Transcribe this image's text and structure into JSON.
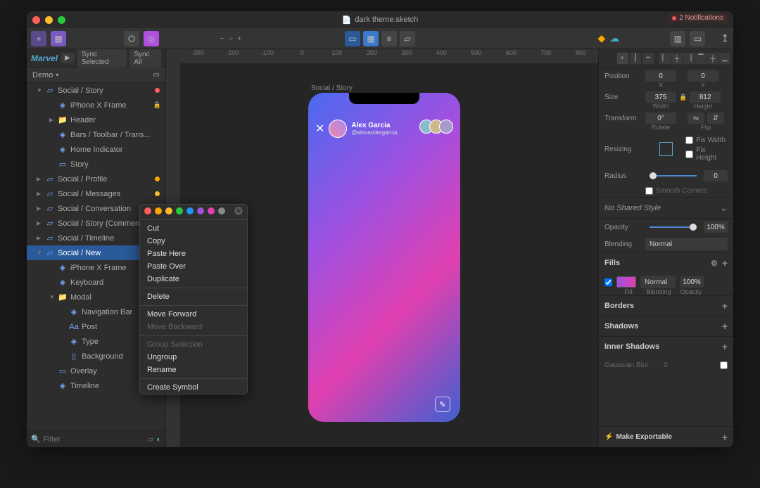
{
  "window": {
    "title": "dark theme.sketch",
    "notifications": "2 Notifications"
  },
  "colors": {
    "red": "#ff5f56",
    "yellow": "#ffbd2e",
    "green": "#27c93f",
    "orange": "#ffa500",
    "blue": "#2196f3",
    "purple": "#a050e0",
    "pink": "#e040b0",
    "gray": "#888"
  },
  "marvel": {
    "logo": "Marvel",
    "play": "▶",
    "sync_selected": "Sync Selected",
    "sync_all": "Sync All"
  },
  "page": {
    "name": "Demo"
  },
  "ruler_marks": [
    "-300",
    "-200",
    "-100",
    "0",
    "100",
    "200",
    "300",
    "400",
    "500",
    "600",
    "700",
    "800"
  ],
  "layers": [
    {
      "id": "l0",
      "caret": "▼",
      "name": "Social / Story",
      "indent": "i1",
      "icon": "artboard",
      "dot": "#ff5f56",
      "sel": false
    },
    {
      "id": "l1",
      "caret": "",
      "name": "iPhone X Frame",
      "indent": "i2",
      "icon": "symbol",
      "lock": true
    },
    {
      "id": "l2",
      "caret": "▶",
      "name": "Header",
      "indent": "i2",
      "icon": "folder"
    },
    {
      "id": "l3",
      "caret": "",
      "name": "Bars / Toolbar / Trans...",
      "indent": "i2",
      "icon": "symbol"
    },
    {
      "id": "l4",
      "caret": "",
      "name": "Home Indicator",
      "indent": "i2",
      "icon": "symbol"
    },
    {
      "id": "l5",
      "caret": "",
      "name": "Story",
      "indent": "i2",
      "icon": "rect"
    },
    {
      "id": "l6",
      "caret": "▶",
      "name": "Social / Profile",
      "indent": "i1",
      "icon": "artboard",
      "dot": "#ffa500"
    },
    {
      "id": "l7",
      "caret": "▶",
      "name": "Social / Messages",
      "indent": "i1",
      "icon": "artboard",
      "dot": "#ffbd2e"
    },
    {
      "id": "l8",
      "caret": "▶",
      "name": "Social / Conversation",
      "indent": "i1",
      "icon": "artboard",
      "dot": "#ffa500"
    },
    {
      "id": "l9",
      "caret": "▶",
      "name": "Social / Story (Comments)",
      "indent": "i1",
      "icon": "artboard",
      "dot": "#27c93f"
    },
    {
      "id": "l10",
      "caret": "▶",
      "name": "Social / Timeline",
      "indent": "i1",
      "icon": "artboard",
      "dot": "#2196f3"
    },
    {
      "id": "l11",
      "caret": "▼",
      "name": "Social / New",
      "indent": "i1",
      "icon": "artboard",
      "sel": true
    },
    {
      "id": "l12",
      "caret": "",
      "name": "iPhone X Frame",
      "indent": "i2",
      "icon": "symbol",
      "lock": true
    },
    {
      "id": "l13",
      "caret": "",
      "name": "Keyboard",
      "indent": "i2",
      "icon": "symbol"
    },
    {
      "id": "l14",
      "caret": "▼",
      "name": "Modal",
      "indent": "i2",
      "icon": "folder"
    },
    {
      "id": "l15",
      "caret": "",
      "name": "Navigation Bar",
      "indent": "i3",
      "icon": "symbol"
    },
    {
      "id": "l16",
      "caret": "",
      "name": "Post",
      "indent": "i3",
      "icon": "text"
    },
    {
      "id": "l17",
      "caret": "",
      "name": "Type",
      "indent": "i3",
      "icon": "symbol"
    },
    {
      "id": "l18",
      "caret": "",
      "name": "Background",
      "indent": "i3",
      "icon": "rect-w"
    },
    {
      "id": "l19",
      "caret": "",
      "name": "Overlay",
      "indent": "i2",
      "icon": "rect"
    },
    {
      "id": "l20",
      "caret": "",
      "name": "Timeline",
      "indent": "i2",
      "icon": "symbol"
    }
  ],
  "filter_placeholder": "Filter",
  "artboard_label": "Social / Story",
  "story": {
    "username": "Alex Garcia",
    "handle": "@alexandergarcia"
  },
  "ctx": {
    "items": [
      {
        "t": "Cut"
      },
      {
        "t": "Copy"
      },
      {
        "t": "Paste Here"
      },
      {
        "t": "Paste Over"
      },
      {
        "t": "Duplicate"
      },
      {
        "sep": true
      },
      {
        "t": "Delete"
      },
      {
        "sep": true
      },
      {
        "t": "Move Forward"
      },
      {
        "t": "Move Backward",
        "dis": true
      },
      {
        "sep": true
      },
      {
        "t": "Group Selection",
        "dis": true
      },
      {
        "t": "Ungroup"
      },
      {
        "t": "Rename"
      },
      {
        "sep": true
      },
      {
        "t": "Create Symbol"
      }
    ]
  },
  "inspector": {
    "position_label": "Position",
    "x": "0",
    "y": "0",
    "x_label": "X",
    "y_label": "Y",
    "size_label": "Size",
    "width": "375",
    "height": "812",
    "w_label": "Width",
    "h_label": "Height",
    "transform_label": "Transform",
    "rotate": "0°",
    "rotate_label": "Rotate",
    "flip_label": "Flip",
    "resizing_label": "Resizing",
    "fix_width": "Fix Width",
    "fix_height": "Fix Height",
    "radius_label": "Radius",
    "radius": "0",
    "smooth": "Smooth Corners",
    "no_style": "No Shared Style",
    "opacity_label": "Opacity",
    "opacity": "100%",
    "blending_label": "Blending",
    "blending": "Normal",
    "fills": "Fills",
    "fill_blend": "Normal",
    "fill_opacity": "100%",
    "fill_sub": "Fill",
    "blend_sub": "Blending",
    "op_sub": "Opacity",
    "borders": "Borders",
    "shadows": "Shadows",
    "inner_shadows": "Inner Shadows",
    "gblur": "Gaussian Blur",
    "gblur_v": "0",
    "exportable": "Make Exportable"
  }
}
